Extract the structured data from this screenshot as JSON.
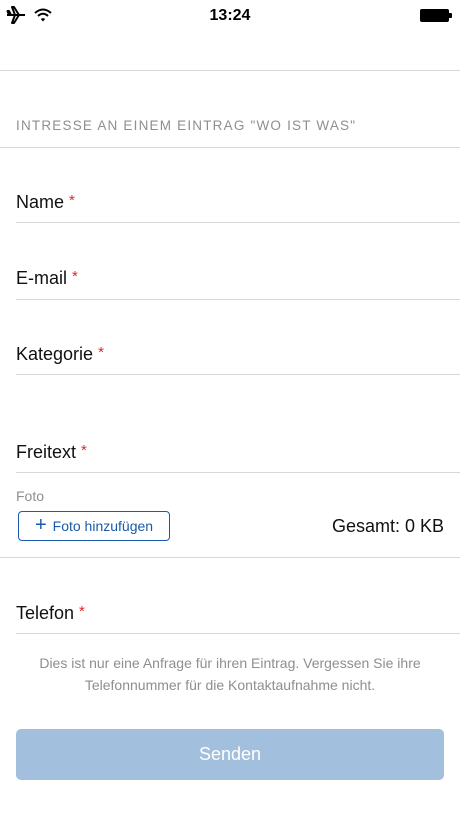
{
  "status_bar": {
    "time": "13:24",
    "icons": [
      "airplane-icon",
      "wifi-icon",
      "battery-icon"
    ]
  },
  "form": {
    "section_title": "INTRESSE AN EINEM EINTRAG \"WO IST WAS\"",
    "required_marker": "*",
    "fields": {
      "name": "Name",
      "email": "E-mail",
      "kategorie": "Kategorie",
      "freitext": "Freitext",
      "telefon": "Telefon"
    },
    "photo": {
      "label": "Foto",
      "add_button": "Foto hinzufügen",
      "add_icon": "plus-icon",
      "total": "Gesamt: 0 KB"
    },
    "hint": "Dies ist nur eine Anfrage für ihren Eintrag. Vergessen Sie ihre Telefonnummer für die Kontaktaufnahme nicht.",
    "submit": "Senden"
  },
  "colors": {
    "required": "#e0262b",
    "accent": "#1a5aa8",
    "submit_disabled": "#a3bfde",
    "muted_text": "#8e8e93",
    "divider": "#d7d7d7"
  }
}
